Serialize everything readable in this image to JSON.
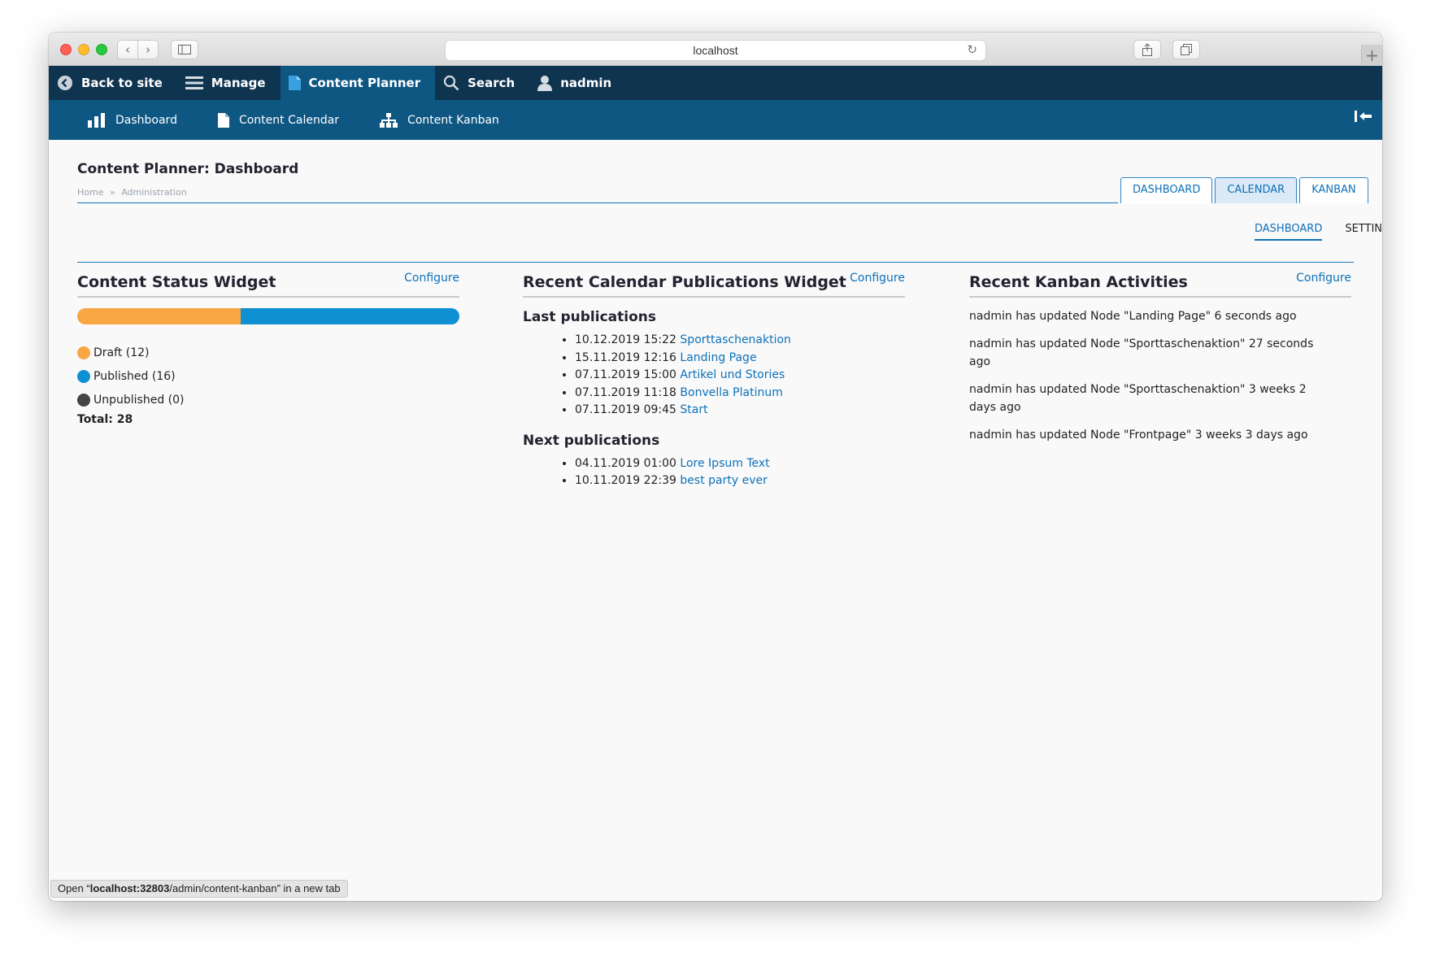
{
  "browser": {
    "address": "localhost",
    "status_bar": {
      "prefix": "Open “",
      "host": "localhost:32803",
      "path": "/admin/content-kanban",
      "suffix": "” in a new tab"
    }
  },
  "toolbar": {
    "items": [
      {
        "label": "Back to site",
        "icon": "back-arrow-icon"
      },
      {
        "label": "Manage",
        "icon": "hamburger-icon"
      },
      {
        "label": "Content Planner",
        "icon": "document-icon"
      },
      {
        "label": "Search",
        "icon": "search-icon"
      },
      {
        "label": "nadmin",
        "icon": "user-icon"
      }
    ],
    "active_color": "#0e5783",
    "bar_color": "#0f3450"
  },
  "tray": {
    "items": [
      {
        "label": "Dashboard",
        "icon": "bar-chart-icon"
      },
      {
        "label": "Content Calendar",
        "icon": "document-icon"
      },
      {
        "label": "Content Kanban",
        "icon": "sitemap-icon"
      }
    ]
  },
  "page": {
    "title": "Content Planner: Dashboard",
    "breadcrumb": {
      "home": "Home",
      "separator": "»",
      "admin": "Administration"
    },
    "primary_tabs": [
      "DASHBOARD",
      "CALENDAR",
      "KANBAN"
    ],
    "secondary_tabs": [
      "DASHBOARD",
      "SETTINGS"
    ]
  },
  "widgets": {
    "content_status": {
      "title": "Content Status Widget",
      "configure": "Configure",
      "draft": {
        "label": "Draft (12)",
        "count": 12,
        "color": "#f9a745"
      },
      "published": {
        "label": "Published (16)",
        "count": 16,
        "color": "#0f90d2"
      },
      "unpublished": {
        "label": "Unpublished (0)",
        "count": 0,
        "color": "#444444"
      },
      "total": "Total: 28"
    },
    "calendar": {
      "title": "Recent Calendar Publications Widget",
      "configure": "Configure",
      "last_heading": "Last publications",
      "last": [
        {
          "date": "10.12.2019 15:22",
          "title": "Sporttaschenaktion"
        },
        {
          "date": "15.11.2019 12:16",
          "title": "Landing Page"
        },
        {
          "date": "07.11.2019 15:00",
          "title": "Artikel und Stories"
        },
        {
          "date": "07.11.2019 11:18",
          "title": "Bonvella Platinum"
        },
        {
          "date": "07.11.2019 09:45",
          "title": "Start"
        }
      ],
      "next_heading": "Next publications",
      "next": [
        {
          "date": "04.11.2019 01:00",
          "title": "Lore Ipsum Text"
        },
        {
          "date": "10.11.2019 22:39",
          "title": "best party ever"
        }
      ]
    },
    "kanban": {
      "title": "Recent Kanban Activities",
      "configure": "Configure",
      "activities": [
        "nadmin has updated Node \"Landing Page\" 6 seconds ago",
        "nadmin has updated Node \"Sporttaschenaktion\" 27 seconds ago",
        "nadmin has updated Node \"Sporttaschenaktion\" 3 weeks 2 days ago",
        "nadmin has updated Node \"Frontpage\" 3 weeks 3 days ago"
      ]
    }
  }
}
